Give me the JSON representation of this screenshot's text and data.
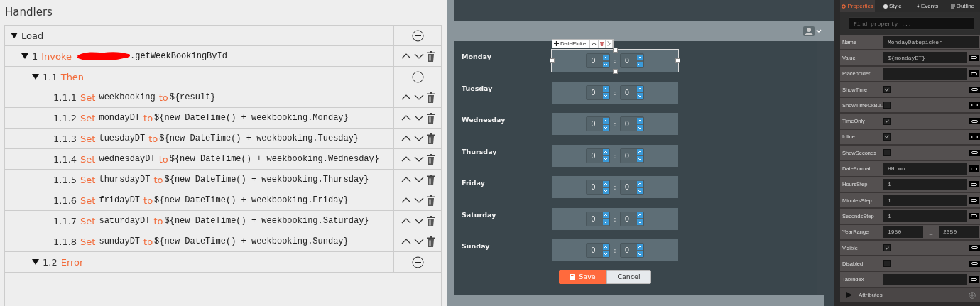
{
  "handlers": {
    "title": "Handlers",
    "tree": [
      {
        "label": "Load",
        "expanded": true,
        "kind": "add",
        "children": [
          {
            "number": "1",
            "keyword": "Invoke",
            "redacted": true,
            "target": ".getWeekBookingById",
            "expanded": true,
            "kind": "move",
            "children": [
              {
                "number": "1.1",
                "keyword": "Then",
                "expanded": true,
                "kind": "add",
                "children": [
                  {
                    "number": "1.1.1",
                    "keyword": "Set",
                    "variable": "weekbooking",
                    "to": "to",
                    "expression": "${result}",
                    "kind": "move"
                  },
                  {
                    "number": "1.1.2",
                    "keyword": "Set",
                    "variable": "mondayDT",
                    "to": "to",
                    "expression": "${new DateTime() + weekbooking.Monday}",
                    "kind": "move"
                  },
                  {
                    "number": "1.1.3",
                    "keyword": "Set",
                    "variable": "tuesdayDT",
                    "to": "to",
                    "expression": "${new DateTime() + weekbooking.Tuesday}",
                    "kind": "move"
                  },
                  {
                    "number": "1.1.4",
                    "keyword": "Set",
                    "variable": "wednesdayDT",
                    "to": "to",
                    "expression": "${new DateTime() + weekbooking.Wednesday}",
                    "kind": "move"
                  },
                  {
                    "number": "1.1.5",
                    "keyword": "Set",
                    "variable": "thursdayDT",
                    "to": "to",
                    "expression": "${new DateTime() + weekbooking.Thursday}",
                    "kind": "move"
                  },
                  {
                    "number": "1.1.6",
                    "keyword": "Set",
                    "variable": "fridayDT",
                    "to": "to",
                    "expression": "${new DateTime() + weekbooking.Friday}",
                    "kind": "move"
                  },
                  {
                    "number": "1.1.7",
                    "keyword": "Set",
                    "variable": "saturdayDT",
                    "to": "to",
                    "expression": "${new DateTime() + weekbooking.Saturday}",
                    "kind": "move"
                  },
                  {
                    "number": "1.1.8",
                    "keyword": "Set",
                    "variable": "sundayDT",
                    "to": "to",
                    "expression": "${new DateTime() + weekbooking.Sunday}",
                    "kind": "move"
                  }
                ]
              },
              {
                "number": "1.2",
                "keyword": "Error",
                "expanded": true,
                "kind": "add"
              }
            ]
          }
        ]
      }
    ]
  },
  "form": {
    "toolbar_label": "DatePicker",
    "rows": [
      {
        "label": "Monday",
        "hours": "0",
        "minutes": "0",
        "separator": ":",
        "selected": true
      },
      {
        "label": "Tuesday",
        "hours": "0",
        "minutes": "0",
        "separator": ":",
        "selected": false
      },
      {
        "label": "Wednesday",
        "hours": "0",
        "minutes": "0",
        "separator": ":",
        "selected": false
      },
      {
        "label": "Thursday",
        "hours": "0",
        "minutes": "0",
        "separator": ":",
        "selected": false
      },
      {
        "label": "Friday",
        "hours": "0",
        "minutes": "0",
        "separator": ":",
        "selected": false
      },
      {
        "label": "Saturday",
        "hours": "0",
        "minutes": "0",
        "separator": ":",
        "selected": false
      },
      {
        "label": "Sunday",
        "hours": "0",
        "minutes": "0",
        "separator": ":",
        "selected": false
      }
    ],
    "buttons": [
      {
        "kind": "primary",
        "label": "Save"
      },
      {
        "kind": "secondary",
        "label": "Cancel"
      }
    ]
  },
  "properties": {
    "tabs": [
      {
        "label": "Properties",
        "selected": true
      },
      {
        "label": "Style",
        "selected": false
      },
      {
        "label": "Events",
        "selected": false
      },
      {
        "label": "Outline",
        "selected": false
      }
    ],
    "search": {
      "placeholder": "Find property ..."
    },
    "rows": [
      {
        "kind": "text",
        "name": "Name",
        "value": "MondayDatepicker",
        "link": false
      },
      {
        "kind": "text",
        "name": "Value",
        "value": "${mondayDT}",
        "link": true
      },
      {
        "kind": "text",
        "name": "Placeholder",
        "link": true
      },
      {
        "kind": "check",
        "name": "ShowTime",
        "checked": true,
        "link": true
      },
      {
        "kind": "check",
        "name": "ShowTimeOkBu...",
        "checked": false,
        "link": true
      },
      {
        "kind": "check",
        "name": "TimeOnly",
        "checked": true,
        "link": true
      },
      {
        "kind": "check",
        "name": "Inline",
        "checked": true,
        "link": true
      },
      {
        "kind": "check",
        "name": "ShowSeconds",
        "checked": false,
        "link": true
      },
      {
        "kind": "text",
        "name": "DateFormat",
        "value": "HH:mm",
        "link": true
      },
      {
        "kind": "text",
        "name": "HoursStep",
        "value": "1",
        "link": true
      },
      {
        "kind": "text",
        "name": "MinutesStep",
        "value": "1",
        "link": true
      },
      {
        "kind": "text",
        "name": "SecondsStep",
        "value": "1",
        "link": true
      },
      {
        "kind": "range",
        "name": "YearRange",
        "from": "1950",
        "separator": "_",
        "to": "2050"
      },
      {
        "kind": "check",
        "name": "Visible",
        "checked": true,
        "link": true
      },
      {
        "kind": "check",
        "name": "Disabled",
        "checked": false,
        "link": true
      },
      {
        "kind": "text",
        "name": "TabIndex",
        "link": true
      }
    ],
    "attributes": {
      "label": "Attributes",
      "expanded": false
    }
  }
}
